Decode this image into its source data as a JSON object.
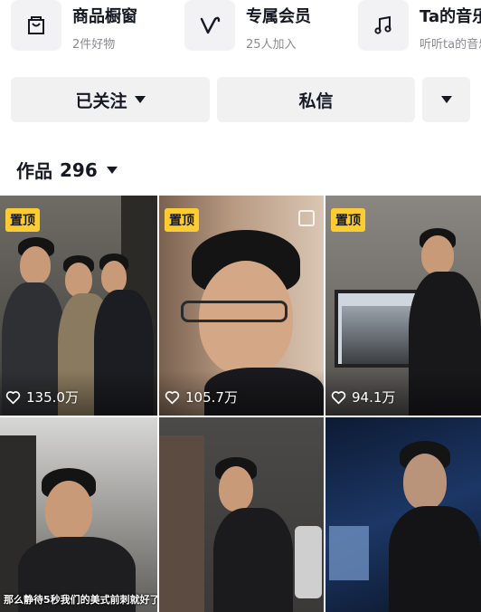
{
  "features": [
    {
      "title": "商品橱窗",
      "subtitle": "2件好物",
      "icon": "shopping-bag-icon"
    },
    {
      "title": "专属会员",
      "subtitle": "25人加入",
      "icon": "heart-v-icon"
    },
    {
      "title": "Ta的音乐",
      "subtitle": "听听ta的音乐",
      "icon": "music-note-icon"
    }
  ],
  "actions": {
    "follow_label": "已关注",
    "message_label": "私信"
  },
  "works": {
    "label": "作品",
    "count": "296"
  },
  "tiles": [
    {
      "badge": "置顶",
      "likes": "135.0万"
    },
    {
      "badge": "置顶",
      "likes": "105.7万"
    },
    {
      "badge": "置顶",
      "likes": "94.1万"
    },
    {
      "caption": "那么静待5秒我们的美式前刺就好了"
    },
    {},
    {}
  ],
  "colors": {
    "badge": "#fecc2e",
    "button_bg": "#f1f1f2",
    "text_primary": "#161823",
    "text_secondary": "#8a8b91"
  }
}
